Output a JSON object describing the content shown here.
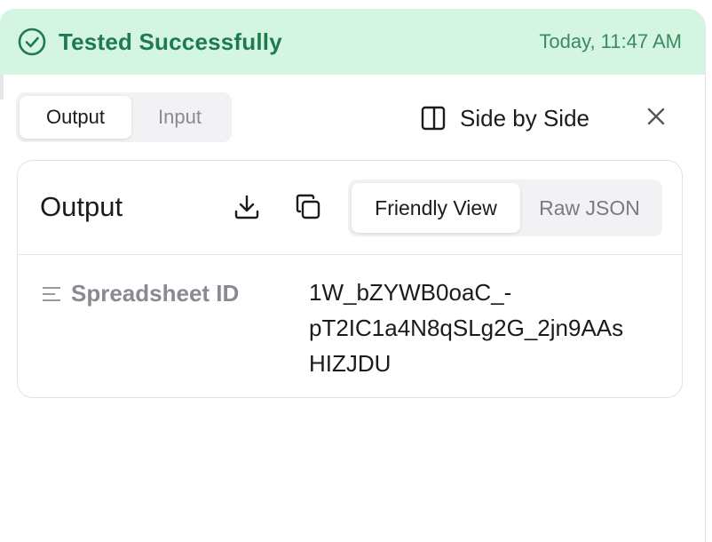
{
  "status": {
    "title": "Tested Successfully",
    "time": "Today, 11:47 AM",
    "icon": "check-circle-icon",
    "color": "#1f7a4d",
    "background": "#d4f5e2"
  },
  "tabs": [
    {
      "label": "Output",
      "active": true
    },
    {
      "label": "Input",
      "active": false
    }
  ],
  "toolbar": {
    "side_by_side_label": "Side by Side",
    "side_by_side_icon": "panel-split-icon",
    "close_icon": "close-icon"
  },
  "card": {
    "title": "Output",
    "download_icon": "download-icon",
    "copy_icon": "copy-icon",
    "views": [
      {
        "label": "Friendly View",
        "active": true
      },
      {
        "label": "Raw JSON",
        "active": false
      }
    ],
    "fields": [
      {
        "icon": "text-lines-icon",
        "label": "Spreadsheet ID",
        "value_lines": [
          "1W_bZYWB0oaC_-",
          "pT2IC1a4N8qSLg2G_2jn9AAs",
          "HIZJDU"
        ]
      }
    ]
  }
}
